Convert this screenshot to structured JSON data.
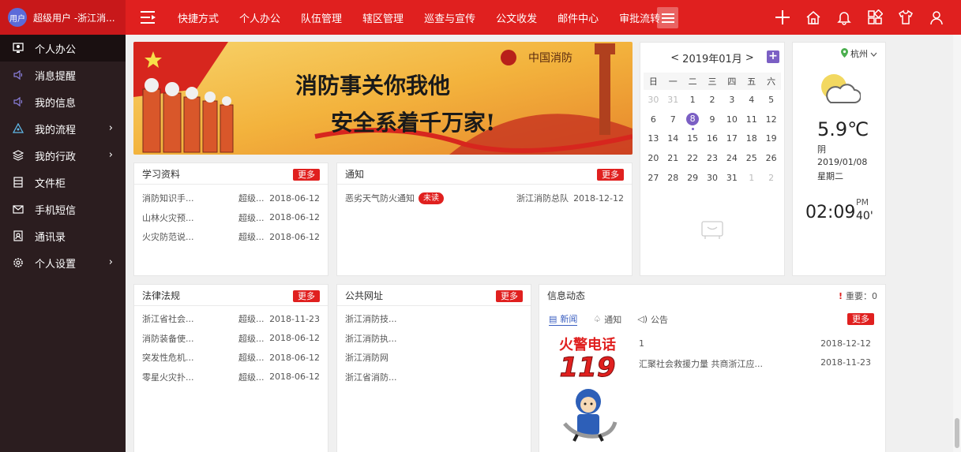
{
  "user": {
    "avatar_text": "用户",
    "name": "超级用户 -浙江消..."
  },
  "nav": {
    "items": [
      "快捷方式",
      "个人办公",
      "队伍管理",
      "辖区管理",
      "巡查与宣传",
      "公文收发",
      "邮件中心",
      "审批流转"
    ]
  },
  "sidebar": {
    "items": [
      {
        "label": "个人办公",
        "icon": "monitor-icon"
      },
      {
        "label": "消息提醒",
        "icon": "speaker-icon"
      },
      {
        "label": "我的信息",
        "icon": "speaker-icon"
      },
      {
        "label": "我的流程",
        "icon": "flow-icon",
        "arrow": "›"
      },
      {
        "label": "我的行政",
        "icon": "layers-icon",
        "arrow": "›"
      },
      {
        "label": "文件柜",
        "icon": "cabinet-icon"
      },
      {
        "label": "手机短信",
        "icon": "mail-icon"
      },
      {
        "label": "通讯录",
        "icon": "contacts-icon"
      },
      {
        "label": "个人设置",
        "icon": "gear-icon",
        "arrow": "›"
      }
    ]
  },
  "study": {
    "title": "学习资料",
    "more": "更多",
    "rows": [
      {
        "title": "消防知识手...",
        "author": "超级...",
        "date": "2018-06-12"
      },
      {
        "title": "山林火灾预...",
        "author": "超级...",
        "date": "2018-06-12"
      },
      {
        "title": "火灾防范说...",
        "author": "超级...",
        "date": "2018-06-12"
      }
    ]
  },
  "notice": {
    "title": "通知",
    "more": "更多",
    "rows": [
      {
        "title": "恶劣天气防火通知",
        "badge": "未读",
        "from": "浙江消防总队",
        "date": "2018-12-12"
      }
    ]
  },
  "law": {
    "title": "法律法规",
    "more": "更多",
    "rows": [
      {
        "title": "浙江省社会...",
        "author": "超级...",
        "date": "2018-11-23"
      },
      {
        "title": "消防装备使...",
        "author": "超级...",
        "date": "2018-06-12"
      },
      {
        "title": "突发性危机...",
        "author": "超级...",
        "date": "2018-06-12"
      },
      {
        "title": "零星火灾扑...",
        "author": "超级...",
        "date": "2018-06-12"
      }
    ]
  },
  "links": {
    "title": "公共网址",
    "more": "更多",
    "rows": [
      "浙江消防技...",
      "浙江消防执...",
      "浙江消防网",
      "浙江省消防..."
    ]
  },
  "info": {
    "title": "信息动态",
    "important": "重要：0",
    "tabs": [
      "新闻",
      "通知",
      "公告"
    ],
    "more": "更多",
    "poster_text": "火警电话",
    "poster_number": "119",
    "rows": [
      {
        "title": "1",
        "date": "2018-12-12"
      },
      {
        "title": "汇聚社会救援力量 共商浙江应...",
        "date": "2018-11-23"
      }
    ]
  },
  "banner": {
    "logo_text": "中国消防",
    "line1": "消防事关你我他",
    "line2": "安全系着千万家!"
  },
  "calendar": {
    "title": "2019年01月",
    "prev": "<",
    "next": ">",
    "dow": [
      "日",
      "一",
      "二",
      "三",
      "四",
      "五",
      "六"
    ],
    "weeks": [
      [
        "30",
        "31",
        "1",
        "2",
        "3",
        "4",
        "5"
      ],
      [
        "6",
        "7",
        "8",
        "9",
        "10",
        "11",
        "12"
      ],
      [
        "13",
        "14",
        "15",
        "16",
        "17",
        "18",
        "19"
      ],
      [
        "20",
        "21",
        "22",
        "23",
        "24",
        "25",
        "26"
      ],
      [
        "27",
        "28",
        "29",
        "30",
        "31",
        "1",
        "2"
      ]
    ],
    "muted": [
      [
        0,
        0
      ],
      [
        0,
        1
      ],
      [
        4,
        5
      ],
      [
        4,
        6
      ]
    ],
    "today": [
      1,
      2
    ]
  },
  "weather": {
    "city": "杭州",
    "temp": "5.9℃",
    "desc": "阴",
    "date": "2019/01/08",
    "weekday": "星期二",
    "time": "02:09",
    "ampm": "PM",
    "seconds": "40'"
  },
  "colors": {
    "brand_red": "#e0201f",
    "sidebar": "#2b1d1f",
    "accent": "#7b5fc4"
  }
}
